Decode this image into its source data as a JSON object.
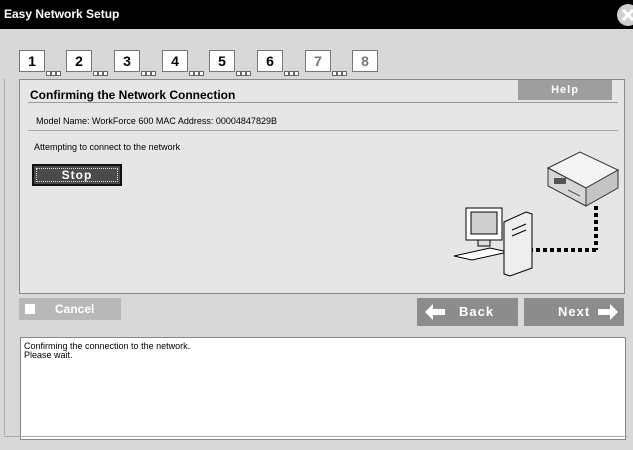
{
  "window": {
    "title": "Easy Network Setup"
  },
  "steps": [
    {
      "num": "1",
      "active": true
    },
    {
      "num": "2",
      "active": true
    },
    {
      "num": "3",
      "active": true
    },
    {
      "num": "4",
      "active": true
    },
    {
      "num": "5",
      "active": true
    },
    {
      "num": "6",
      "active": true
    },
    {
      "num": "7",
      "active": false
    },
    {
      "num": "8",
      "active": false
    }
  ],
  "panel": {
    "title": "Confirming the Network Connection",
    "help_label": "Help",
    "model_info": "Model Name: WorkForce 600   MAC Address: 00004847829B",
    "status": "Attempting to connect to the network",
    "stop_label": "Stop"
  },
  "buttons": {
    "cancel": "Cancel",
    "back": "Back",
    "next": "Next"
  },
  "message": {
    "line1": "Confirming the connection to the network.",
    "line2": "Please wait."
  },
  "colors": {
    "titlebar": "#000000",
    "window_bg": "#d8d8d8",
    "button_gray": "#8c8c8c"
  }
}
